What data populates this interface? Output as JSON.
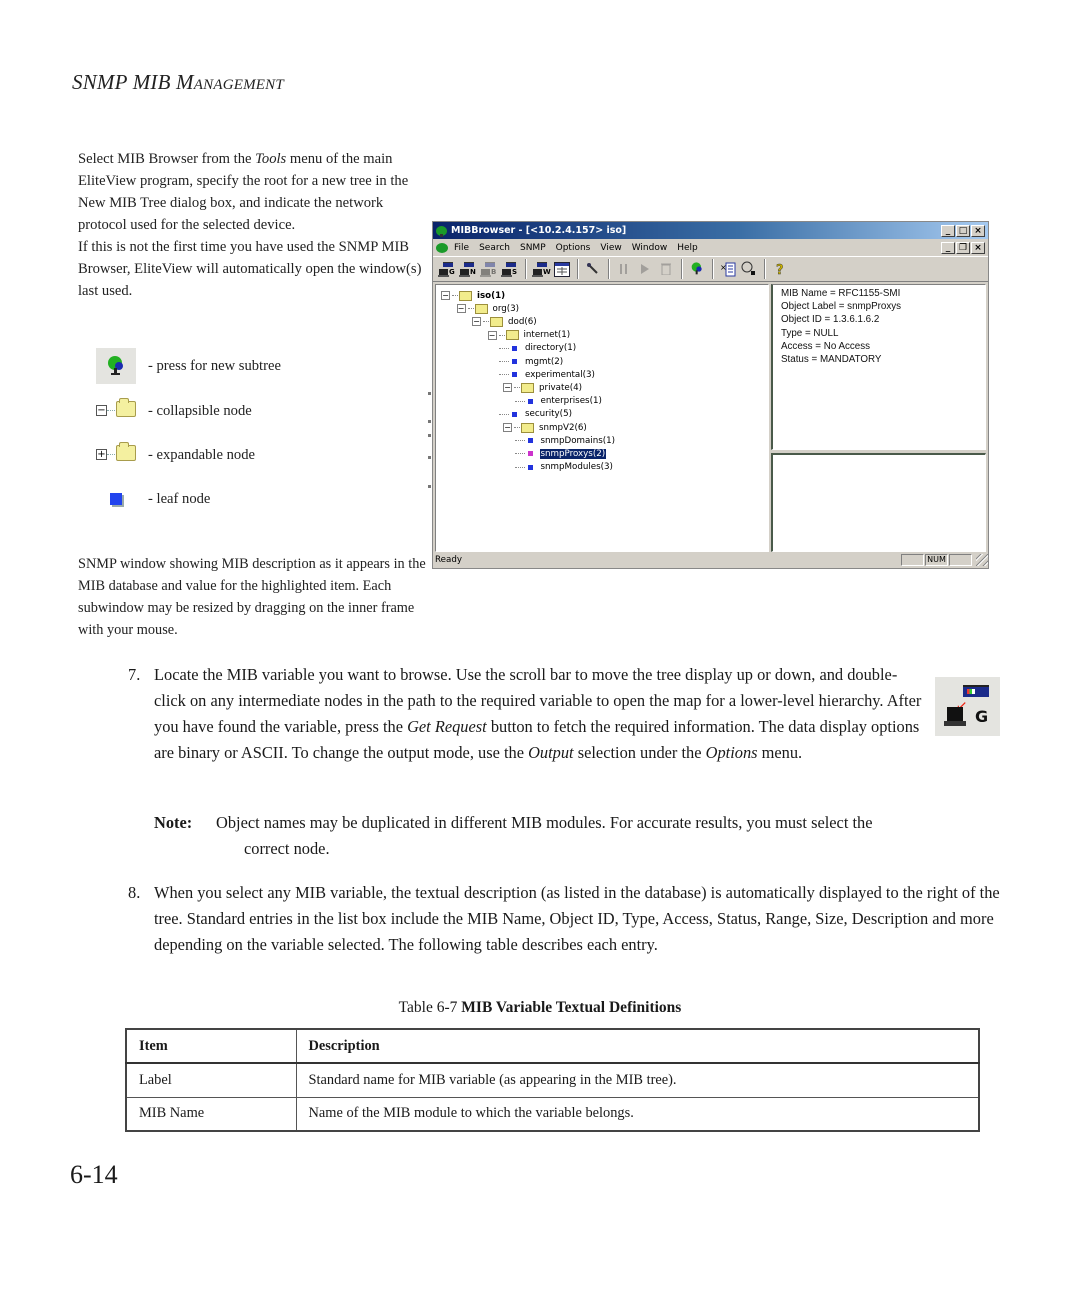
{
  "header": {
    "title_prefix": "SNMP MIB M",
    "title_smallcaps": "ANAGEMENT"
  },
  "intro": {
    "para1_a": "Select MIB Browser from the ",
    "para1_em": "Tools",
    "para1_b": " menu of the main EliteView program, specify the root for a new tree in the New MIB Tree dialog box, and indicate the network protocol used for the selected device.",
    "para2": "If this is not the first time you have used the SNMP MIB Browser, EliteView will automatically open the window(s) last used."
  },
  "legend": [
    {
      "icon": "tree-icon",
      "label": "- press for new subtree"
    },
    {
      "icon": "collapse-folder-icon",
      "toggle": "−",
      "label": "- collapsible node"
    },
    {
      "icon": "expand-folder-icon",
      "toggle": "+",
      "label": "- expandable node"
    },
    {
      "icon": "leaf-node-icon",
      "label": "- leaf node"
    }
  ],
  "caption": "SNMP window showing MIB description as it appears in the MIB database and value for the highlighted item. Each subwindow may be resized by dragging on the inner frame with your mouse.",
  "window": {
    "title": "MIBBrowser - [<10.2.4.157> iso]",
    "title_controls": [
      "_",
      "□",
      "×"
    ],
    "menu_controls": [
      "_",
      "❐",
      "×"
    ],
    "menu": [
      "File",
      "Search",
      "SNMP",
      "Options",
      "View",
      "Window",
      "Help"
    ],
    "toolbar": [
      {
        "name": "get-request-icon",
        "letter": "G"
      },
      {
        "name": "get-next-icon",
        "letter": "N"
      },
      {
        "name": "get-bulk-icon",
        "letter": "B",
        "disabled": true
      },
      {
        "name": "set-request-icon",
        "letter": "S"
      },
      {
        "name": "walk-icon",
        "letter": "W"
      },
      {
        "name": "table-view-icon"
      },
      {
        "name": "probe-icon"
      },
      {
        "name": "pause-icon",
        "disabled": true
      },
      {
        "name": "play-icon",
        "disabled": true
      },
      {
        "name": "trash-icon",
        "disabled": true
      },
      {
        "name": "new-subtree-icon"
      },
      {
        "name": "export-icon"
      },
      {
        "name": "find-icon"
      },
      {
        "name": "help-icon"
      }
    ],
    "tree": [
      {
        "label": "iso(1)",
        "type": "folder",
        "level": 0,
        "bold": true
      },
      {
        "label": "org(3)",
        "type": "folder",
        "level": 1
      },
      {
        "label": "dod(6)",
        "type": "folder",
        "level": 2
      },
      {
        "label": "internet(1)",
        "type": "folder",
        "level": 3
      },
      {
        "label": "directory(1)",
        "type": "leaf",
        "level": 4
      },
      {
        "label": "mgmt(2)",
        "type": "leaf",
        "level": 4
      },
      {
        "label": "experimental(3)",
        "type": "leaf",
        "level": 4
      },
      {
        "label": "private(4)",
        "type": "folder",
        "level": 4
      },
      {
        "label": "enterprises(1)",
        "type": "leaf",
        "level": 5
      },
      {
        "label": "security(5)",
        "type": "leaf",
        "level": 4
      },
      {
        "label": "snmpV2(6)",
        "type": "folder",
        "level": 4
      },
      {
        "label": "snmpDomains(1)",
        "type": "leaf",
        "level": 5
      },
      {
        "label": "snmpProxys(2)",
        "type": "leaf",
        "level": 5,
        "selected": true
      },
      {
        "label": "snmpModules(3)",
        "type": "leaf",
        "level": 5
      }
    ],
    "info": [
      "MIB Name = RFC1155-SMI",
      "Object Label = snmpProxys",
      "Object ID = 1.3.6.1.6.2",
      "Type = NULL",
      "Access = No Access",
      "Status = MANDATORY"
    ],
    "status": {
      "text": "Ready",
      "num": "NUM"
    }
  },
  "step7": {
    "num": "7.",
    "a": "Locate the MIB variable you want to browse. Use the scroll bar to move the tree display up or down, and double-click on any intermediate nodes in the path to the required variable to open the map for a lower-level hierarchy. After you have found the variable, press the ",
    "em1": "Get Request",
    "b": " button to fetch the required information. The data display options are binary or ASCII. To change the output mode, use the ",
    "em2": "Output",
    "c": " selection under the ",
    "em3": "Options",
    "d": " menu."
  },
  "get_button": {
    "letter": "G"
  },
  "note": {
    "label": "Note:",
    "line1": "Object names may be duplicated in different MIB modules. For accurate results, you must select the",
    "line2": "correct node."
  },
  "step8": {
    "num": "8.",
    "text": "When you select any MIB variable, the textual description (as listed in the database) is automatically displayed to the right of the tree. Standard entries in the list box include the MIB Name, Object ID, Type, Access, Status, Range, Size, Description and more depending on the variable selected. The following table describes each entry."
  },
  "table": {
    "caption_prefix": "Table 6-7",
    "caption_title": "  MIB Variable Textual Definitions",
    "headers": [
      "Item",
      "Description"
    ],
    "rows": [
      [
        "Label",
        "Standard name for MIB variable (as appearing in the MIB tree)."
      ],
      [
        "MIB Name",
        "Name of the MIB module to which the variable belongs."
      ]
    ]
  },
  "page_number": "6-14"
}
